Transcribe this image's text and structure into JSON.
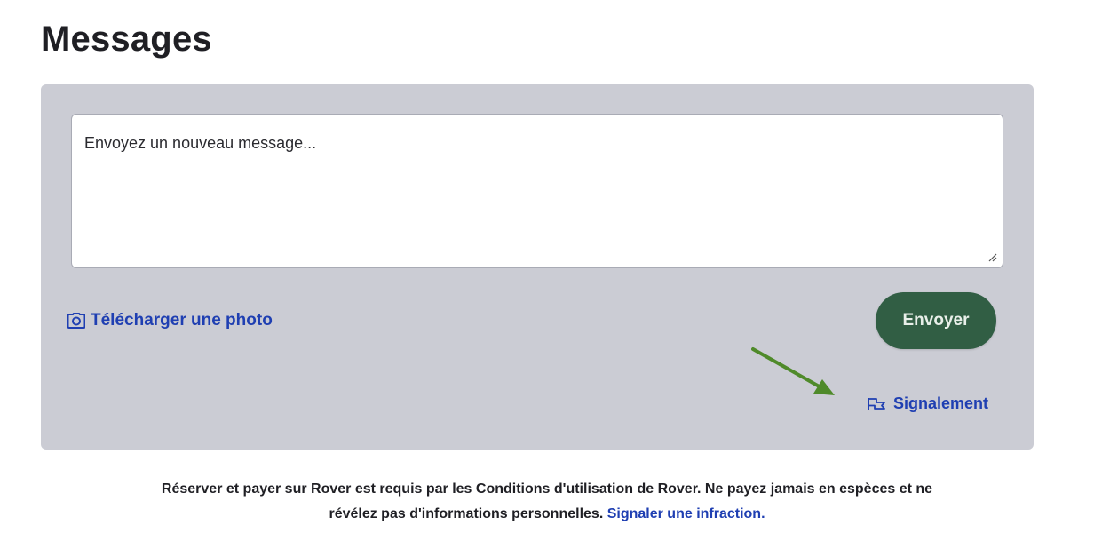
{
  "page": {
    "title": "Messages"
  },
  "composer": {
    "placeholder": "Envoyez un nouveau message...",
    "upload_label": "Télécharger une photo",
    "upload_icon": "camera-icon",
    "send_label": "Envoyer",
    "report_label": "Signalement",
    "report_icon": "flag-icon"
  },
  "footer": {
    "line1": "Réserver et payer sur Rover est requis par les Conditions d'utilisation de Rover. Ne payez jamais en espèces et ne",
    "line2_text": "révélez pas d'informations personnelles.",
    "line2_link": "Signaler une infraction."
  },
  "colors": {
    "card_background": "#cbccd4",
    "send_button": "#315e44",
    "link": "#1f3fb2",
    "annotation_arrow": "#4f8a2a"
  }
}
